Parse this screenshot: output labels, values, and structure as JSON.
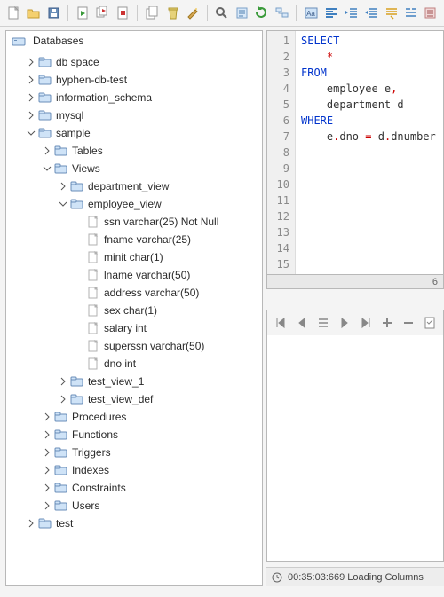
{
  "toolbar": {
    "buttons": [
      {
        "id": "new",
        "title": "New"
      },
      {
        "id": "open",
        "title": "Open"
      },
      {
        "id": "save",
        "title": "Save"
      },
      {
        "id": "sep"
      },
      {
        "id": "execute",
        "title": "Execute"
      },
      {
        "id": "execute-all",
        "title": "Execute All"
      },
      {
        "id": "stop",
        "title": "Stop"
      },
      {
        "id": "sep"
      },
      {
        "id": "copy",
        "title": "Copy"
      },
      {
        "id": "trash",
        "title": "Delete"
      },
      {
        "id": "wizard",
        "title": "Wizard"
      },
      {
        "id": "sep"
      },
      {
        "id": "find",
        "title": "Find"
      },
      {
        "id": "format",
        "title": "Format"
      },
      {
        "id": "refresh",
        "title": "Refresh"
      },
      {
        "id": "schema",
        "title": "Schema"
      },
      {
        "id": "sep"
      },
      {
        "id": "uppercase",
        "title": "Uppercase"
      },
      {
        "id": "align-left",
        "title": "Align Left"
      },
      {
        "id": "indent",
        "title": "Indent"
      },
      {
        "id": "outdent",
        "title": "Outdent"
      },
      {
        "id": "comment",
        "title": "Comment"
      },
      {
        "id": "uncomment",
        "title": "Uncomment"
      },
      {
        "id": "lines",
        "title": "Lines"
      }
    ]
  },
  "tree": {
    "root_label": "Databases",
    "nodes": [
      {
        "label": "db space",
        "icon": "folder",
        "depth": 1,
        "tw": "closed"
      },
      {
        "label": "hyphen-db-test",
        "icon": "folder",
        "depth": 1,
        "tw": "closed"
      },
      {
        "label": "information_schema",
        "icon": "folder",
        "depth": 1,
        "tw": "closed"
      },
      {
        "label": "mysql",
        "icon": "folder",
        "depth": 1,
        "tw": "closed"
      },
      {
        "label": "sample",
        "icon": "folder",
        "depth": 1,
        "tw": "open"
      },
      {
        "label": "Tables",
        "icon": "folder",
        "depth": 2,
        "tw": "closed"
      },
      {
        "label": "Views",
        "icon": "folder",
        "depth": 2,
        "tw": "open"
      },
      {
        "label": "department_view",
        "icon": "folder",
        "depth": 3,
        "tw": "closed"
      },
      {
        "label": "employee_view",
        "icon": "folder",
        "depth": 3,
        "tw": "open"
      },
      {
        "label": "ssn varchar(25) Not Null",
        "icon": "column",
        "depth": 4,
        "tw": "none"
      },
      {
        "label": "fname varchar(25)",
        "icon": "column",
        "depth": 4,
        "tw": "none"
      },
      {
        "label": "minit char(1)",
        "icon": "column",
        "depth": 4,
        "tw": "none"
      },
      {
        "label": "lname varchar(50)",
        "icon": "column",
        "depth": 4,
        "tw": "none"
      },
      {
        "label": "address varchar(50)",
        "icon": "column",
        "depth": 4,
        "tw": "none"
      },
      {
        "label": "sex char(1)",
        "icon": "column",
        "depth": 4,
        "tw": "none"
      },
      {
        "label": "salary int",
        "icon": "column",
        "depth": 4,
        "tw": "none"
      },
      {
        "label": "superssn varchar(50)",
        "icon": "column",
        "depth": 4,
        "tw": "none"
      },
      {
        "label": "dno int",
        "icon": "column",
        "depth": 4,
        "tw": "none"
      },
      {
        "label": "test_view_1",
        "icon": "folder",
        "depth": 3,
        "tw": "closed"
      },
      {
        "label": "test_view_def",
        "icon": "folder",
        "depth": 3,
        "tw": "closed"
      },
      {
        "label": "Procedures",
        "icon": "folder",
        "depth": 2,
        "tw": "closed"
      },
      {
        "label": "Functions",
        "icon": "folder",
        "depth": 2,
        "tw": "closed"
      },
      {
        "label": "Triggers",
        "icon": "folder",
        "depth": 2,
        "tw": "closed"
      },
      {
        "label": "Indexes",
        "icon": "folder",
        "depth": 2,
        "tw": "closed"
      },
      {
        "label": "Constraints",
        "icon": "folder",
        "depth": 2,
        "tw": "closed"
      },
      {
        "label": "Users",
        "icon": "folder",
        "depth": 2,
        "tw": "closed"
      },
      {
        "label": "test",
        "icon": "folder",
        "depth": 1,
        "tw": "closed"
      }
    ]
  },
  "editor": {
    "lines": [
      {
        "n": 1,
        "tokens": [
          {
            "t": "SELECT",
            "c": "kw"
          }
        ]
      },
      {
        "n": 2,
        "tokens": [
          {
            "t": "    ",
            "c": ""
          },
          {
            "t": "*",
            "c": "ast"
          }
        ]
      },
      {
        "n": 3,
        "tokens": [
          {
            "t": "FROM",
            "c": "kw"
          }
        ]
      },
      {
        "n": 4,
        "tokens": [
          {
            "t": "    employee e",
            "c": ""
          },
          {
            "t": ",",
            "c": "op"
          }
        ]
      },
      {
        "n": 5,
        "tokens": [
          {
            "t": "    department d",
            "c": ""
          }
        ]
      },
      {
        "n": 6,
        "tokens": [
          {
            "t": "WHERE",
            "c": "kw"
          }
        ]
      },
      {
        "n": 7,
        "tokens": [
          {
            "t": "    e",
            "c": ""
          },
          {
            "t": ".",
            "c": "op"
          },
          {
            "t": "dno ",
            "c": ""
          },
          {
            "t": "=",
            "c": "op"
          },
          {
            "t": " d",
            "c": ""
          },
          {
            "t": ".",
            "c": "op"
          },
          {
            "t": "dnumber",
            "c": ""
          }
        ]
      },
      {
        "n": 8,
        "tokens": [
          {
            "t": "",
            "c": ""
          }
        ],
        "current": true
      },
      {
        "n": 9,
        "tokens": []
      },
      {
        "n": 10,
        "tokens": []
      },
      {
        "n": 11,
        "tokens": []
      },
      {
        "n": 12,
        "tokens": []
      },
      {
        "n": 13,
        "tokens": []
      },
      {
        "n": 14,
        "tokens": []
      },
      {
        "n": 15,
        "tokens": []
      }
    ]
  },
  "results_toolbar": {
    "buttons": [
      {
        "id": "first"
      },
      {
        "id": "prev"
      },
      {
        "id": "new-row"
      },
      {
        "id": "next"
      },
      {
        "id": "last"
      },
      {
        "id": "add"
      },
      {
        "id": "delete"
      },
      {
        "id": "commit"
      }
    ]
  },
  "scroll_indicator": "6",
  "statusbar": {
    "text": "00:35:03:669 Loading Columns"
  }
}
